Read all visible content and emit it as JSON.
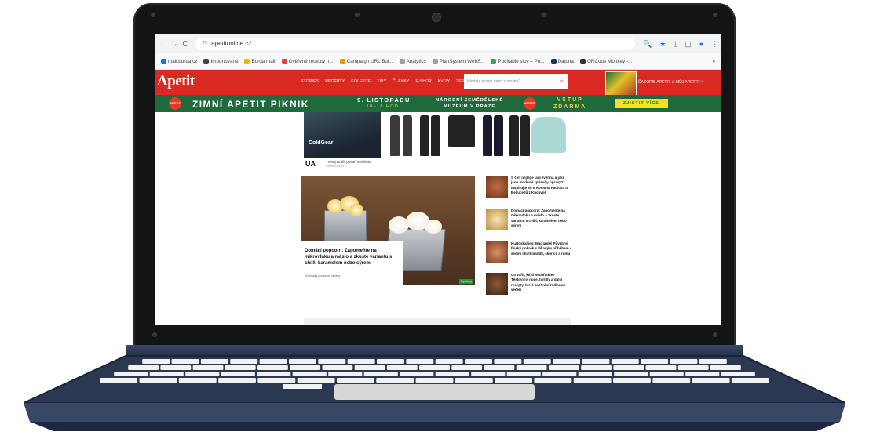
{
  "browser": {
    "url": "apetitonline.cz",
    "nav": {
      "back": "←",
      "forward": "→",
      "reload": "C",
      "site_info": "☷"
    },
    "toolbar_icons": {
      "zoom": "🔍",
      "star": "★",
      "download": "⤓",
      "sidebar": "◫",
      "profile": "●",
      "menu": "⋮"
    },
    "bookmarks": [
      {
        "label": "mail.burda.cz",
        "color": "#1a73e8"
      },
      {
        "label": "Importované",
        "color": "#444444"
      },
      {
        "label": "Burda mail",
        "color": "#f2b600"
      },
      {
        "label": "Ověřené recepty n...",
        "color": "#e34133"
      },
      {
        "label": "Campaign URL Bui...",
        "color": "#f29900"
      },
      {
        "label": "Analytics",
        "color": "#9aa0a6"
      },
      {
        "label": "PlanSystem WebS...",
        "color": "#9aa0a6"
      },
      {
        "label": "Počítadlo slov – Po...",
        "color": "#34a853"
      },
      {
        "label": "Datona",
        "color": "#1d3557"
      },
      {
        "label": "QRCode Monkey -...",
        "color": "#333333"
      }
    ],
    "bookmarks_more": "»"
  },
  "site": {
    "logo": "Apetit",
    "nav": [
      "STORIES",
      "RECEPTY",
      "KOLEKCE",
      "TIPY",
      "ČLÁNKY",
      "E-SHOP",
      "KVÍZY",
      "TESTOVÁNÍ"
    ],
    "nav_active": "RECEPTY",
    "search_placeholder": "Hledáte recept nebo surovinu?",
    "header_links": "ČASOPIS APETIT   ♙ MŮJ APETIT   🛒"
  },
  "banner": {
    "badge": "APETIT",
    "title": "ZIMNÍ APETIT PIKNIK",
    "date": "9. LISTOPADU",
    "time": "10–18 HOD.",
    "place_1": "NÁRODNÍ ZEMĚDĚLSKÉ",
    "place_2": "MUZEUM V PRAZE",
    "free_1": "VSTUP",
    "free_2": "ZDARMA",
    "cta": "ZJISTIT VÍCE"
  },
  "ad": {
    "label": "ColdGear",
    "brand": "UA",
    "headline": "Trénuj tvrdě, posuň své limity",
    "sub": "Under Armour"
  },
  "feature": {
    "title": "Domácí popcorn: Zapomeňte na mikrovlnku a máslo a zkuste variantu s chilli, karamelem nebo sýrem",
    "meta": "Sochacký podzimní večery",
    "tag": "Top story"
  },
  "sidebar": [
    {
      "title": "S čím nejlépe ladí zvěřina a jaké jsou moderní způsoby úpravy? Inspirujte se u Romana Paulusa a Bellucellů z Kuchyně"
    },
    {
      "title": "Domácí popcorn: Zapomeňte na mikrovlnku a máslo a zkuste variantu s chilli, karamelem nebo sýrem"
    },
    {
      "title": "Kurtoskalács: Maďarský Půvabný finský pokrok s lákavým příběhem a sedmi chutí mandlí, skořice a rumu"
    },
    {
      "title": "Co vařit, když nechřadíte? Těstoviny, rajce, tortilly a další recepty, které zachrání rodinnou večeři"
    }
  ]
}
